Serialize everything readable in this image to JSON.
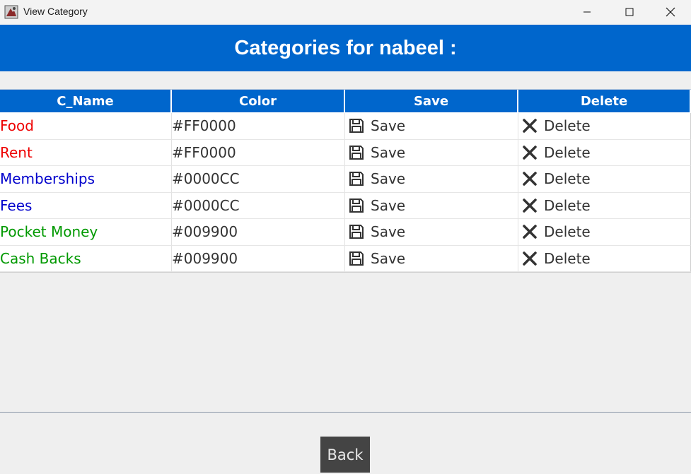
{
  "window": {
    "title": "View Category"
  },
  "banner": {
    "title": "Categories for nabeel :"
  },
  "table": {
    "headers": [
      "C_Name",
      "Color",
      "Save",
      "Delete"
    ],
    "rows": [
      {
        "name": "Food",
        "color": "#FF0000",
        "text_color": "#ee0000",
        "save": "Save",
        "delete": "Delete"
      },
      {
        "name": "Rent",
        "color": "#FF0000",
        "text_color": "#ee0000",
        "save": "Save",
        "delete": "Delete"
      },
      {
        "name": "Memberships",
        "color": "#0000CC",
        "text_color": "#0000cc",
        "save": "Save",
        "delete": "Delete"
      },
      {
        "name": "Fees",
        "color": "#0000CC",
        "text_color": "#0000cc",
        "save": "Save",
        "delete": "Delete"
      },
      {
        "name": "Pocket Money",
        "color": "#009900",
        "text_color": "#009900",
        "save": "Save",
        "delete": "Delete"
      },
      {
        "name": "Cash Backs",
        "color": "#009900",
        "text_color": "#009900",
        "save": "Save",
        "delete": "Delete"
      }
    ]
  },
  "footer": {
    "back_label": "Back"
  },
  "icons": {
    "app": "app-icon",
    "save": "floppy-disk-icon",
    "delete": "x-icon"
  }
}
